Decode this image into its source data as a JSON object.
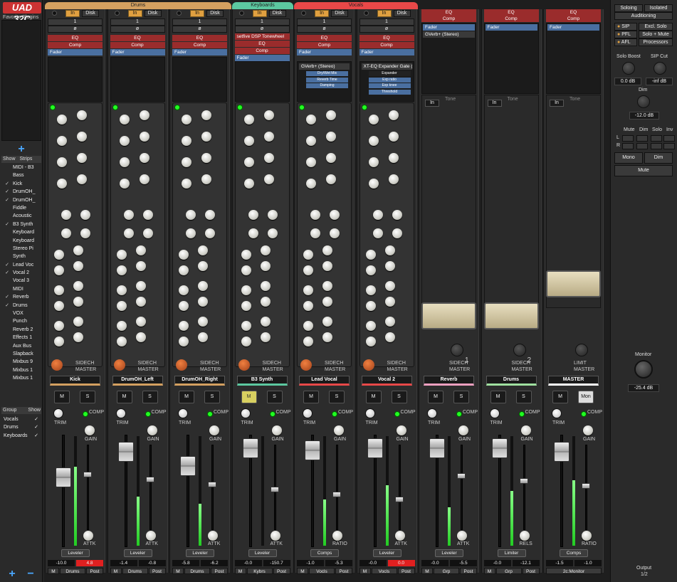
{
  "app": {
    "logo": "UAD 32C",
    "favorites_label": "Favorite Plugins"
  },
  "left": {
    "show_label": "Show",
    "strips_label": "Strips",
    "strips": [
      {
        "checked": false,
        "name": "MIDI - B3"
      },
      {
        "checked": false,
        "name": "Bass"
      },
      {
        "checked": true,
        "name": "Kick"
      },
      {
        "checked": true,
        "name": "DrumOH_"
      },
      {
        "checked": true,
        "name": "DrumOH_"
      },
      {
        "checked": false,
        "name": "Fiddle"
      },
      {
        "checked": false,
        "name": "Acoustic"
      },
      {
        "checked": true,
        "name": "B3 Synth"
      },
      {
        "checked": false,
        "name": "Keyboard"
      },
      {
        "checked": false,
        "name": "Keyboard"
      },
      {
        "checked": false,
        "name": "Stereo Pi"
      },
      {
        "checked": false,
        "name": "Synth"
      },
      {
        "checked": true,
        "name": "Lead Voc"
      },
      {
        "checked": true,
        "name": "Vocal 2"
      },
      {
        "checked": false,
        "name": "Vocal 3"
      },
      {
        "checked": false,
        "name": "MIDI"
      },
      {
        "checked": true,
        "name": "Reverb"
      },
      {
        "checked": true,
        "name": "Drums"
      },
      {
        "checked": false,
        "name": "VOX"
      },
      {
        "checked": false,
        "name": "Punch"
      },
      {
        "checked": false,
        "name": "Reverb 2"
      },
      {
        "checked": false,
        "name": "Effects 1"
      },
      {
        "checked": false,
        "name": "Aux Bus"
      },
      {
        "checked": false,
        "name": "Slapback"
      },
      {
        "checked": false,
        "name": "Mixbus 9"
      },
      {
        "checked": false,
        "name": "Mixbus 1"
      },
      {
        "checked": false,
        "name": "Mixbus 1"
      }
    ],
    "group_label": "Group",
    "group_show_label": "Show",
    "groups": [
      {
        "name": "Vocals",
        "checked": true
      },
      {
        "name": "Drums",
        "checked": true
      },
      {
        "name": "Keyboards",
        "checked": true
      }
    ]
  },
  "groups": [
    {
      "name": "Drums",
      "color": "#d4a060"
    },
    {
      "name": "Keyboards",
      "color": "#5cc8a0"
    },
    {
      "name": "Vocals",
      "color": "#e84848"
    }
  ],
  "common": {
    "in": "In",
    "disk": "Disk",
    "one": "1",
    "phase": "ø",
    "eq": "EQ",
    "comp": "Comp",
    "fader": "Fader",
    "m": "M",
    "s": "S",
    "trim": "TRIM",
    "comp_lbl": "COMP",
    "gain": "GAIN",
    "attk": "ATTK",
    "ratio": "RATIO",
    "rels": "RELS",
    "sidech": "SIDECH",
    "master": "MASTER",
    "tone": "Tone",
    "drive": "Drive",
    "limit": "LIMIT"
  },
  "strips": [
    {
      "name": "Kick",
      "color": "#d4a060",
      "leveler": "Leveler",
      "fader_val": "-10.0",
      "peak": "4.8",
      "peak_red": true,
      "route": "M",
      "grp": "Drums",
      "post": "Post",
      "knob3": "ATTK",
      "meter": 0.72,
      "fader_pos": 0.38,
      "ms": [
        "M",
        "S"
      ]
    },
    {
      "name": "DrumOH_Left",
      "color": "#d4a060",
      "leveler": "Leveler",
      "fader_val": "-1.4",
      "peak": "-0.8",
      "peak_red": false,
      "route": "M",
      "grp": "Drums",
      "post": "Post",
      "knob3": "ATTK",
      "meter": 0.45,
      "fader_pos": 0.15,
      "ms": [
        "M",
        "S"
      ]
    },
    {
      "name": "DrumOH_Right",
      "color": "#d4a060",
      "leveler": "Leveler",
      "fader_val": "-5.8",
      "peak": "-6.2",
      "peak_red": false,
      "route": "M",
      "grp": "Drums",
      "post": "Post",
      "knob3": "ATTK",
      "meter": 0.38,
      "fader_pos": 0.28,
      "ms": [
        "M",
        "S"
      ]
    },
    {
      "name": "B3 Synth",
      "color": "#5cc8a0",
      "leveler": "Leveler",
      "fader_val": "-0.0",
      "peak": "-150.7",
      "peak_red": false,
      "route": "M",
      "grp": "Kybrs",
      "post": "Post",
      "knob3": "ATTK",
      "meter": 0.0,
      "fader_pos": 0.12,
      "ms": [
        "M",
        "S"
      ],
      "mute_yellow": true
    },
    {
      "name": "Lead Vocal",
      "color": "#e84848",
      "leveler": "Comps",
      "fader_val": "-1.0",
      "peak": "-5.3",
      "peak_red": false,
      "route": "M",
      "grp": "Vocls",
      "post": "Post",
      "knob3": "RATIO",
      "meter": 0.42,
      "fader_pos": 0.14,
      "ms": [
        "M",
        "S"
      ]
    },
    {
      "name": "Vocal 2",
      "color": "#e84848",
      "leveler": "Leveler",
      "fader_val": "-0.0",
      "peak": "0.0",
      "peak_red": true,
      "route": "M",
      "grp": "Vocls",
      "post": "Post",
      "knob3": "ATTK",
      "meter": 0.55,
      "fader_pos": 0.12,
      "ms": [
        "M",
        "S"
      ]
    },
    {
      "name": "Reverb",
      "color": "#f0a0c0",
      "leveler": "Leveler",
      "fader_val": "-0.0",
      "peak": "-5.5",
      "peak_red": false,
      "route": "M",
      "grp": "Grp",
      "post": "Post",
      "knob3": "ATTK",
      "meter": 0.35,
      "fader_pos": 0.12,
      "ms": [
        "M",
        "S"
      ],
      "num": "1"
    },
    {
      "name": "Drums",
      "color": "#a0e0a0",
      "leveler": "Limiter",
      "fader_val": "-0.0",
      "peak": "-12.1",
      "peak_red": false,
      "route": "M",
      "grp": "Grp",
      "post": "Post",
      "knob3": "RELS",
      "meter": 0.5,
      "fader_pos": 0.12,
      "ms": [
        "M",
        "S"
      ],
      "num": "2"
    },
    {
      "name": "MASTER",
      "color": "#ffffff",
      "leveler": "Comps",
      "fader_val": "-1.5",
      "peak": "-1.0",
      "peak_red": false,
      "route": "2c:Monitor",
      "grp": "",
      "post": "",
      "knob3": "RATIO",
      "meter": 0.6,
      "fader_pos": 0.15,
      "ms": [
        "M",
        "Mon"
      ]
    }
  ],
  "inserts": [
    {
      "slots": [],
      "eq": "EQ",
      "comp": "Comp",
      "fader": "Fader"
    },
    {
      "slots": [],
      "eq": "EQ",
      "comp": "Comp",
      "fader": "Fader"
    },
    {
      "slots": [],
      "eq": "EQ",
      "comp": "Comp",
      "fader": "Fader"
    },
    {
      "slots": [
        "setfive DSP Tonewheel"
      ],
      "eq": "EQ",
      "comp": "Comp",
      "fader": "Fader"
    },
    {
      "slots": [
        "GVerb+ (Stereo)"
      ],
      "sub": [
        "Dry/Wet Mix",
        "Reverb Time",
        "Damping"
      ],
      "eq": "EQ",
      "comp": "Comp",
      "fader": "Fader"
    },
    {
      "slots": [
        "XT-EQ Expander Gate (M"
      ],
      "sub": [
        "Expander",
        "Exp ratio",
        "Exp knee",
        "Threshold"
      ],
      "eq": "EQ",
      "comp": "Comp",
      "fader": "Fader"
    }
  ],
  "bus_inserts": [
    {
      "eq": "EQ",
      "comp": "Comp",
      "fader": "Fader",
      "slot": "GVerb+ (Stereo)"
    },
    {
      "eq": "EQ",
      "comp": "Comp",
      "fader": "Fader",
      "slot": ""
    },
    {
      "eq": "EQ",
      "comp": "Comp",
      "fader": "Fader",
      "slot": ""
    }
  ],
  "right": {
    "soloing": "Soloing",
    "isolated": "Isolated",
    "auditioning": "Auditioning",
    "sip": "SIP",
    "excl_solo": "Excl. Solo",
    "pfl": "PFL",
    "solo_mute": "Solo + Mute",
    "afl": "AFL",
    "processors": "Processors",
    "solo_boost": "Solo Boost",
    "sip_cut": "SIP Cut",
    "solo_boost_val": "0.0 dB",
    "sip_cut_val": "-inf dB",
    "dim": "Dim",
    "dim_val": "-12.0 dB",
    "mute": "Mute",
    "dim2": "Dim",
    "solo": "Solo",
    "inv": "Inv",
    "l": "L",
    "r": "R",
    "mono": "Mono",
    "dim_btn": "Dim",
    "mute_btn": "Mute",
    "monitor": "Monitor",
    "monitor_val": "-25.4 dB",
    "output": "Output",
    "output_val": "1/2"
  }
}
